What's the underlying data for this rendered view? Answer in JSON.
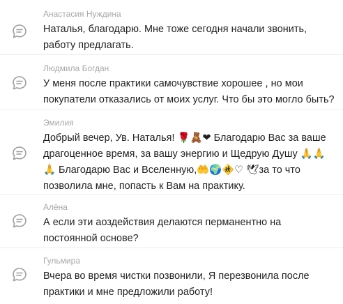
{
  "comments": [
    {
      "author": "Анастасия Нуждина",
      "lines": [
        "Наталья, благодарю. Мне тоже сегодня начали звонить,",
        "работу предлагать."
      ],
      "icon": "comment-icon"
    },
    {
      "author": "Людмила Богдан",
      "lines": [
        "У меня после практики самочувствие хорошее , но мои",
        "покупатели отказались от моих услуг. Что бы это могло быть?"
      ],
      "icon": "comment-icon"
    },
    {
      "author": "Эмилия",
      "lines": [
        "Добрый вечер, Ув. Наталья! 🌹🧸❤ Благодарю Вас за ваше",
        "драгоценное время, за вашу энергию и Щедрую Душу 🙏🙏",
        "🙏 Благодарю Вас и Вселенную,🤲🌍🚸♡ 🕊за то что",
        "позволила мне, попасть к Вам на практику."
      ],
      "icon": "comment-icon"
    },
    {
      "author": "Алёна",
      "lines": [
        "А если эти аоздействия делаются перманентно на",
        "постоянной основе?"
      ],
      "icon": "comment-icon"
    },
    {
      "author": "Гульмира",
      "lines": [
        "Вчера во время чистки позвонили, Я перезвонила после",
        "практики и мне предложили работу!"
      ],
      "icon": "comment-icon"
    }
  ],
  "colors": {
    "author": "#a8a8a8",
    "text": "#1f1f1f",
    "icon": "#9e9e9e",
    "divider": "#ececec"
  }
}
